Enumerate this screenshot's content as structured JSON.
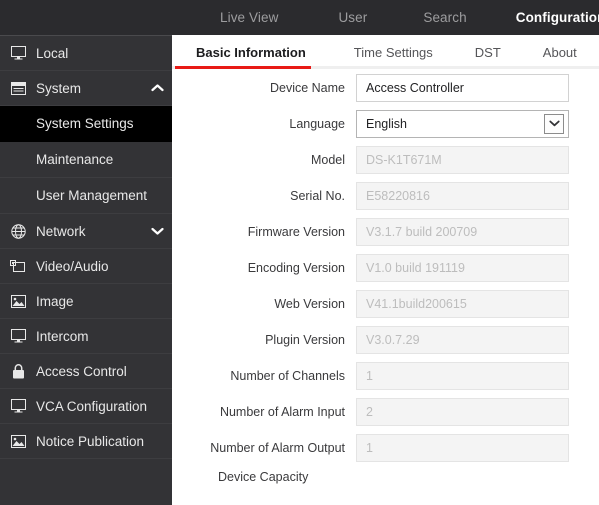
{
  "topnav": {
    "items": [
      {
        "label": "Live View",
        "active": false
      },
      {
        "label": "User",
        "active": false
      },
      {
        "label": "Search",
        "active": false
      },
      {
        "label": "Configuration",
        "active": true
      }
    ]
  },
  "sidebar": {
    "items": [
      {
        "label": "Local",
        "icon": "monitor-icon",
        "type": "item"
      },
      {
        "label": "System",
        "icon": "window-icon",
        "type": "group",
        "chevron": "chevron-up-icon"
      },
      {
        "label": "System Settings",
        "type": "sub",
        "selected": true
      },
      {
        "label": "Maintenance",
        "type": "sub",
        "selected": false
      },
      {
        "label": "User Management",
        "type": "sub",
        "selected": false
      },
      {
        "label": "Network",
        "icon": "globe-icon",
        "type": "group",
        "chevron": "chevron-down-icon"
      },
      {
        "label": "Video/Audio",
        "icon": "video-icon",
        "type": "item"
      },
      {
        "label": "Image",
        "icon": "image-icon",
        "type": "item"
      },
      {
        "label": "Intercom",
        "icon": "monitor-icon",
        "type": "item"
      },
      {
        "label": "Access Control",
        "icon": "lock-icon",
        "type": "item"
      },
      {
        "label": "VCA Configuration",
        "icon": "monitor-icon",
        "type": "item"
      },
      {
        "label": "Notice Publication",
        "icon": "image-icon",
        "type": "item"
      }
    ]
  },
  "tabs": [
    {
      "label": "Basic Information",
      "active": true
    },
    {
      "label": "Time Settings",
      "active": false
    },
    {
      "label": "DST",
      "active": false
    },
    {
      "label": "About",
      "active": false
    }
  ],
  "form": {
    "fields": [
      {
        "label": "Device Name",
        "value": "Access Controller",
        "type": "text",
        "readonly": false
      },
      {
        "label": "Language",
        "value": "English",
        "type": "select",
        "readonly": false
      },
      {
        "label": "Model",
        "value": "DS-K1T671M",
        "type": "text",
        "readonly": true
      },
      {
        "label": "Serial No.",
        "value": "E58220816",
        "type": "text",
        "readonly": true
      },
      {
        "label": "Firmware Version",
        "value": "V3.1.7 build 200709",
        "type": "text",
        "readonly": true
      },
      {
        "label": "Encoding Version",
        "value": "V1.0 build 191119",
        "type": "text",
        "readonly": true
      },
      {
        "label": "Web Version",
        "value": "V41.1build200615",
        "type": "text",
        "readonly": true
      },
      {
        "label": "Plugin Version",
        "value": "V3.0.7.29",
        "type": "text",
        "readonly": true
      },
      {
        "label": "Number of Channels",
        "value": "1",
        "type": "text",
        "readonly": true
      },
      {
        "label": "Number of Alarm Input",
        "value": "2",
        "type": "text",
        "readonly": true
      },
      {
        "label": "Number of Alarm Output",
        "value": "1",
        "type": "text",
        "readonly": true
      }
    ],
    "section_title": "Device Capacity"
  },
  "colors": {
    "topnav_bg": "#2b2b2e",
    "sidebar_bg": "#333336",
    "selected_bg": "#000000",
    "accent_red": "#e81a16",
    "readonly_bg": "#f4f4f4"
  }
}
